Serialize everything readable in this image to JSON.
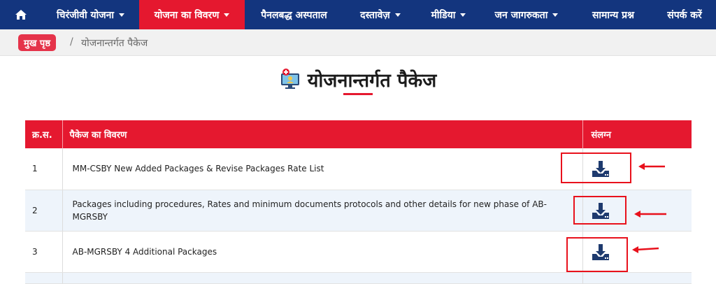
{
  "nav": {
    "home_icon": "home-icon",
    "items": [
      {
        "label": "चिरंजीवी योजना",
        "has_caret": true,
        "active": false
      },
      {
        "label": "योजना का विवरण",
        "has_caret": true,
        "active": true
      },
      {
        "label": "पैनलबद्ध अस्पताल",
        "has_caret": false,
        "active": false
      },
      {
        "label": "दस्तावेज़",
        "has_caret": true,
        "active": false
      },
      {
        "label": "मीडिया",
        "has_caret": true,
        "active": false
      },
      {
        "label": "जन जागरुकता",
        "has_caret": true,
        "active": false
      },
      {
        "label": "सामान्य प्रश्न",
        "has_caret": false,
        "active": false
      },
      {
        "label": "संपर्क करें",
        "has_caret": false,
        "active": false
      }
    ]
  },
  "breadcrumb": {
    "home": "मुख पृष्ठ",
    "separator": "/",
    "current": "योजनान्तर्गत पैकेज"
  },
  "page": {
    "title": "योजनान्तर्गत पैकेज",
    "title_icon": "computer-health-icon"
  },
  "table": {
    "headers": [
      "क्र.स.",
      "पैकेज का विवरण",
      "संलग्न"
    ],
    "rows": [
      {
        "sn": "1",
        "desc": "MM-CSBY New Added Packages & Revise Packages Rate List",
        "attachment_icon": "download-icon"
      },
      {
        "sn": "2",
        "desc": "Packages including procedures, Rates and minimum documents protocols and other details for new phase of AB-MGRSBY",
        "attachment_icon": "download-icon"
      },
      {
        "sn": "3",
        "desc": "AB-MGRSBY 4 Additional Packages",
        "attachment_icon": "download-icon"
      }
    ]
  },
  "colors": {
    "nav_bg": "#13357e",
    "accent_red": "#e5182f",
    "icon_navy": "#1e3a6e",
    "row_alt": "#eef4fb"
  }
}
